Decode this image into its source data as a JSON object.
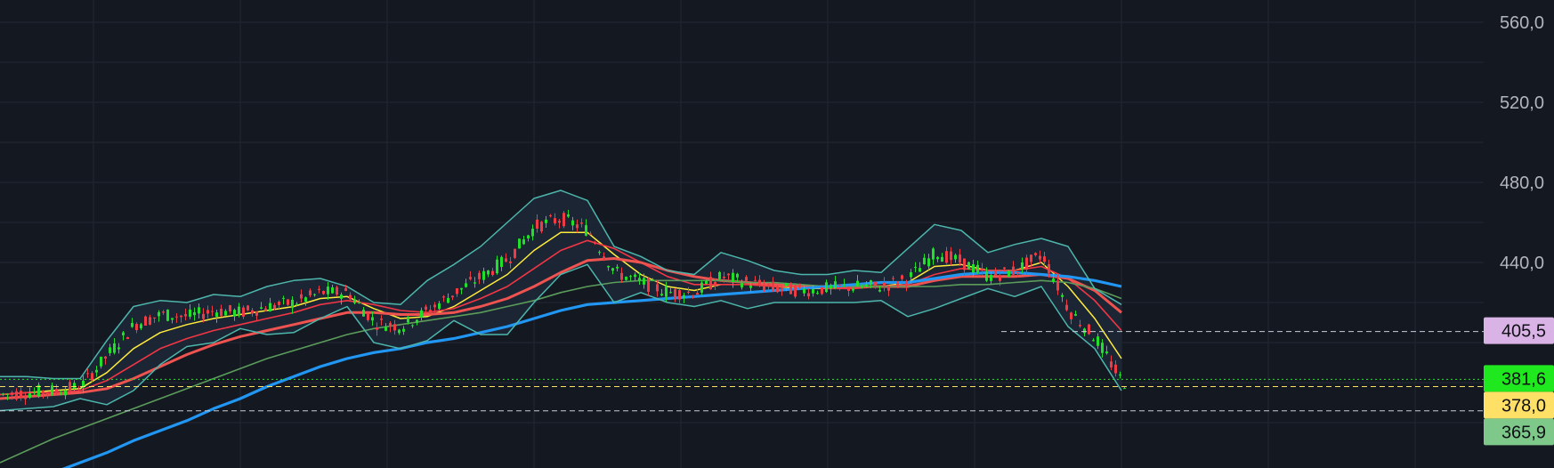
{
  "chart_data": {
    "type": "line",
    "title": "",
    "xlabel": "",
    "ylabel": "",
    "ylim": [
      342,
      570
    ],
    "y_ticks": [
      "560,0",
      "520,0",
      "480,0",
      "440,0"
    ],
    "grid": true,
    "price_tags": [
      {
        "name": "",
        "label": "405,5",
        "value": 405.5,
        "color": "#d9b3e6"
      },
      {
        "name": "",
        "label": "381,6",
        "value": 381.6,
        "color": "#1fe81f"
      },
      {
        "name": "",
        "label": "378,0",
        "value": 378.0,
        "color": "#ffe066"
      },
      {
        "name": "",
        "label": "365,9",
        "value": 365.9,
        "color": "#7ec98a"
      }
    ],
    "x": [
      0,
      30,
      60,
      90,
      120,
      150,
      180,
      210,
      240,
      270,
      300,
      330,
      360,
      390,
      420,
      450,
      480,
      510,
      540,
      570,
      600,
      630,
      660,
      690,
      720,
      750,
      780,
      810,
      840,
      870,
      900,
      930,
      960,
      990,
      1020,
      1050,
      1080,
      1110,
      1140,
      1170,
      1200,
      1230,
      1260
    ],
    "close": [
      374,
      375,
      376,
      378,
      394,
      409,
      414,
      413,
      416,
      415,
      418,
      420,
      425,
      425,
      410,
      408,
      416,
      425,
      433,
      442,
      458,
      462,
      456,
      435,
      430,
      425,
      425,
      433,
      430,
      427,
      426,
      427,
      428,
      428,
      432,
      445,
      440,
      433,
      436,
      444,
      416,
      402,
      380
    ],
    "series": [
      {
        "name": "",
        "color": "#ffeb3b",
        "values": [
          374,
          375,
          376,
          377,
          385,
          397,
          405,
          409,
          412,
          414,
          416,
          418,
          422,
          423,
          417,
          412,
          413,
          418,
          426,
          434,
          446,
          455,
          455,
          444,
          434,
          428,
          426,
          429,
          429,
          428,
          427,
          427,
          428,
          428,
          430,
          438,
          439,
          436,
          436,
          440,
          428,
          412,
          392
        ]
      },
      {
        "name": "",
        "color": "#f23645",
        "values": [
          374,
          375,
          375,
          376,
          381,
          389,
          397,
          402,
          406,
          409,
          412,
          415,
          419,
          421,
          419,
          416,
          415,
          417,
          422,
          428,
          437,
          446,
          451,
          447,
          440,
          433,
          429,
          429,
          429,
          428,
          428,
          427,
          427,
          428,
          429,
          434,
          437,
          436,
          436,
          438,
          432,
          421,
          406
        ]
      },
      {
        "name": "",
        "color": "#ef5350",
        "values": [
          372,
          373,
          374,
          375,
          377,
          382,
          388,
          394,
          399,
          403,
          406,
          409,
          412,
          415,
          415,
          414,
          414,
          415,
          418,
          422,
          428,
          435,
          441,
          442,
          440,
          436,
          433,
          431,
          430,
          429,
          428,
          428,
          428,
          428,
          428,
          431,
          433,
          433,
          433,
          434,
          432,
          426,
          415
        ]
      },
      {
        "name": "",
        "color": "#5b9c5b",
        "values": [
          340,
          346,
          352,
          357,
          362,
          367,
          372,
          377,
          382,
          387,
          392,
          396,
          400,
          404,
          407,
          409,
          411,
          413,
          415,
          418,
          421,
          425,
          428,
          430,
          431,
          431,
          431,
          431,
          430,
          430,
          429,
          428,
          428,
          428,
          428,
          428,
          429,
          429,
          430,
          431,
          430,
          427,
          422
        ]
      },
      {
        "name": "",
        "color": "#2196f3",
        "values": [
          326,
          330,
          335,
          340,
          345,
          351,
          356,
          361,
          367,
          372,
          378,
          383,
          388,
          392,
          395,
          397,
          400,
          402,
          405,
          408,
          412,
          416,
          419,
          420,
          421,
          422,
          423,
          424,
          425,
          426,
          427,
          428,
          429,
          430,
          430,
          432,
          434,
          435,
          435,
          434,
          433,
          431,
          428
        ]
      },
      {
        "name": "",
        "color": "#4db6ac",
        "values": [
          383,
          383,
          382,
          382,
          401,
          418,
          421,
          420,
          424,
          423,
          428,
          431,
          432,
          428,
          420,
          419,
          431,
          439,
          448,
          460,
          472,
          476,
          471,
          448,
          443,
          436,
          434,
          445,
          441,
          436,
          434,
          434,
          436,
          435,
          447,
          459,
          456,
          445,
          449,
          452,
          448,
          427,
          419
        ]
      },
      {
        "name": "",
        "color": "#4db6ac",
        "values": [
          366,
          367,
          368,
          372,
          369,
          376,
          389,
          398,
          400,
          407,
          404,
          405,
          412,
          418,
          400,
          397,
          401,
          411,
          404,
          404,
          420,
          434,
          439,
          420,
          425,
          420,
          418,
          421,
          417,
          420,
          420,
          420,
          420,
          421,
          413,
          417,
          422,
          427,
          423,
          428,
          408,
          397,
          376
        ]
      }
    ]
  }
}
